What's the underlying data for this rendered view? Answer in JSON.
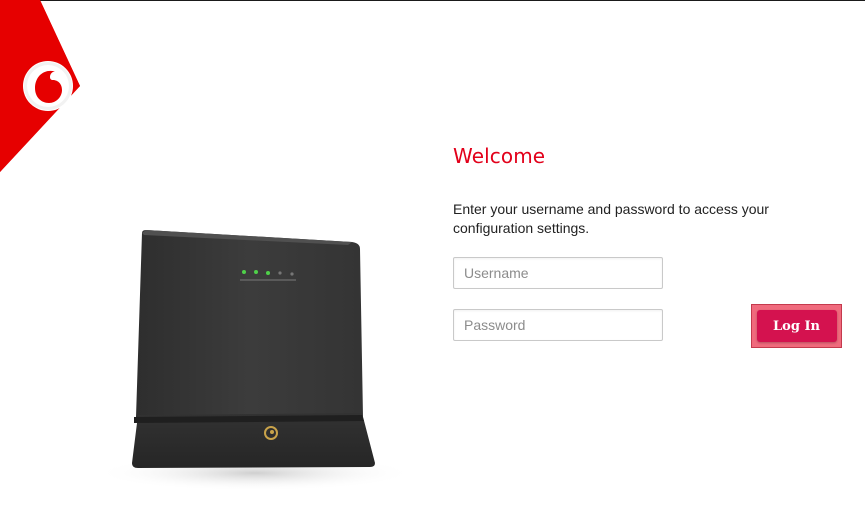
{
  "login": {
    "title": "Welcome",
    "instructions": "Enter your username and password to access your configuration settings.",
    "username_placeholder": "Username",
    "password_placeholder": "Password",
    "login_label": "Log In"
  },
  "icons": {
    "brand_logo": "speechmark-logo-icon",
    "device": "router-device-icon"
  },
  "colors": {
    "brand_red": "#e2001a",
    "button": "#d4124f",
    "button_highlight": "#f06a7d"
  }
}
